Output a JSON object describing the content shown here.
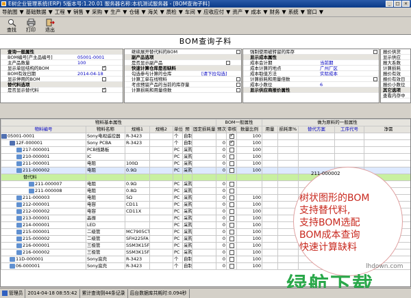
{
  "window": {
    "title": "E树企业管理系统(ERP) 5版本号:1.20.01  服务器名称:本机测试服务器  - [BOM查询子料]"
  },
  "menu": [
    "导航图",
    "基础数据",
    "工程",
    "销售",
    "采购",
    "生产",
    "仓储",
    "海关",
    "质检",
    "车间",
    "应收应付",
    "资产",
    "成本",
    "财务",
    "系统",
    "窗口"
  ],
  "toolbar": {
    "search": "查找",
    "print": "打印",
    "exit": "退出"
  },
  "form_title": "BOM查询子料",
  "panel1": [
    {
      "t": "sec",
      "label": "查询一般属性"
    },
    {
      "t": "val",
      "label": "BOM编号[产主品编号]",
      "value": "05001-0001"
    },
    {
      "t": "val",
      "label": "主产品数量",
      "value": "100"
    },
    {
      "t": "chk",
      "label": "显示单层结构的BOM",
      "checked": true
    },
    {
      "t": "val",
      "label": "BOM有效日期",
      "value": "2014-04-18"
    },
    {
      "t": "chk",
      "label": "显示停用的BOM",
      "checked": false
    },
    {
      "t": "sec",
      "label": "替代料选项"
    },
    {
      "t": "chk",
      "label": "是否显示替代料",
      "checked": true
    }
  ],
  "panel2": [
    {
      "t": "plain",
      "label": "继续展开替代料的BOM"
    },
    {
      "t": "sec",
      "label": "副产品选项"
    },
    {
      "t": "chk",
      "label": "是否显示副产品",
      "checked": false
    },
    {
      "t": "sec",
      "label": "快速计算仓库是否缺料"
    },
    {
      "t": "val",
      "label": "勾选参与计算的仓库",
      "value": "[请下拉勾选]"
    },
    {
      "t": "plain",
      "label": "计算工单在线物料"
    },
    {
      "t": "plain",
      "label": "考虑预留产品的当前的库存量"
    },
    {
      "t": "plain",
      "label": "计算损耗和用量倍数"
    }
  ],
  "panel3": [
    {
      "t": "plain",
      "label": "强制使用被转留的库存"
    },
    {
      "t": "sec",
      "label": "显示成本属性"
    },
    {
      "t": "val",
      "label": "成本会计期",
      "value": "当前期"
    },
    {
      "t": "val",
      "label": "成本计算的地点",
      "value": "广州厂区"
    },
    {
      "t": "val",
      "label": "成本取值方法",
      "value": "实际成本"
    },
    {
      "t": "plain",
      "label": "计算损耗和用量倍数"
    },
    {
      "t": "val",
      "label": "成本小数位",
      "value": "6"
    },
    {
      "t": "sec",
      "label": "显示供应商报价属性"
    }
  ],
  "panel4": [
    "报价供货",
    "显示供应",
    "报大系数",
    "计算损耗",
    "报价有效",
    "报价有效日",
    "报价小数位",
    "其它选项",
    "查看内存中"
  ],
  "grid": {
    "group_headers": [
      "物料基本属性",
      "BOM一般属性",
      "做为原料的一般属性"
    ],
    "columns": [
      "物料编号",
      "物料名称",
      "规格1",
      "规格2",
      "单位",
      "预",
      "固定损耗量",
      "预次",
      "审核",
      "数量比例",
      "用量",
      "损耗率%",
      "替代方案",
      "工序代号",
      "净需"
    ],
    "rows": [
      {
        "code": "05001-0001",
        "name": "Sony电视遥控器",
        "spec1": "R-3423",
        "spec2": "",
        "unit": "个",
        "src": "自制",
        "fixloss": "",
        "seq": "",
        "aud": true,
        "ratio": "100",
        "usage": "",
        "loss": "",
        "alt": "",
        "op": "",
        "net": ""
      },
      {
        "code": "12F-000001",
        "name": "Sony PCBA",
        "spec1": "R-3423",
        "spec2": "",
        "unit": "个",
        "src": "自制",
        "fixloss": "",
        "seq": "0",
        "aud": true,
        "ratio": "100",
        "usage": "",
        "loss": "",
        "alt": "",
        "op": "",
        "net": ""
      },
      {
        "code": "217-000001",
        "name": "PCB线路板",
        "spec1": "",
        "spec2": "",
        "unit": "PC",
        "src": "采购",
        "fixloss": "",
        "seq": "0",
        "aud": false,
        "ratio": "100",
        "usage": "",
        "loss": "",
        "alt": "",
        "op": "",
        "net": ""
      },
      {
        "code": "210-000001",
        "name": "IC",
        "spec1": "",
        "spec2": "",
        "unit": "PC",
        "src": "采购",
        "fixloss": "",
        "seq": "0",
        "aud": false,
        "ratio": "100",
        "usage": "",
        "loss": "",
        "alt": "",
        "op": "",
        "net": ""
      },
      {
        "code": "211-000001",
        "name": "电阻",
        "spec1": "100Ω",
        "spec2": "",
        "unit": "PC",
        "src": "采购",
        "fixloss": "",
        "seq": "0",
        "aud": false,
        "ratio": "100",
        "usage": "",
        "loss": "",
        "alt": "",
        "op": "",
        "net": ""
      },
      {
        "code": "211-000002",
        "name": "电阻",
        "spec1": "0.9Ω",
        "spec2": "",
        "unit": "PC",
        "src": "采购",
        "fixloss": "",
        "seq": "0",
        "aud": false,
        "ratio": "100",
        "usage": "",
        "loss": "",
        "alt": "",
        "op": "",
        "net": ""
      },
      {
        "code": "替代料",
        "name": "",
        "spec1": "",
        "spec2": "",
        "unit": "",
        "src": "",
        "fixloss": "",
        "seq": "",
        "aud": null,
        "ratio": "",
        "usage": "",
        "loss": "",
        "alt": "",
        "op": "",
        "net": ""
      },
      {
        "code": "211-000007",
        "name": "电阻",
        "spec1": "0.9Ω",
        "spec2": "",
        "unit": "PC",
        "src": "采购",
        "fixloss": "",
        "seq": "0",
        "aud": false,
        "ratio": "",
        "usage": "",
        "loss": "",
        "alt": "",
        "op": "",
        "net": ""
      },
      {
        "code": "211-000008",
        "name": "电阻",
        "spec1": "0.8Ω",
        "spec2": "",
        "unit": "PC",
        "src": "采购",
        "fixloss": "",
        "seq": "0",
        "aud": false,
        "ratio": "",
        "usage": "",
        "loss": "",
        "alt": "",
        "op": "",
        "net": ""
      },
      {
        "code": "211-000003",
        "name": "电阻",
        "spec1": "5Ω",
        "spec2": "",
        "unit": "PC",
        "src": "采购",
        "fixloss": "",
        "seq": "0",
        "aud": false,
        "ratio": "100",
        "usage": "",
        "loss": "",
        "alt": "",
        "op": "",
        "net": ""
      },
      {
        "code": "212-000001",
        "name": "电容",
        "spec1": "CD11",
        "spec2": "",
        "unit": "PC",
        "src": "采购",
        "fixloss": "",
        "seq": "0",
        "aud": false,
        "ratio": "100",
        "usage": "",
        "loss": "",
        "alt": "",
        "op": "",
        "net": ""
      },
      {
        "code": "212-000002",
        "name": "电容",
        "spec1": "CD11X",
        "spec2": "",
        "unit": "PC",
        "src": "采购",
        "fixloss": "",
        "seq": "0",
        "aud": false,
        "ratio": "100",
        "usage": "",
        "loss": "",
        "alt": "",
        "op": "",
        "net": ""
      },
      {
        "code": "213-000001",
        "name": "晶振",
        "spec1": "",
        "spec2": "",
        "unit": "PC",
        "src": "采购",
        "fixloss": "",
        "seq": "0",
        "aud": false,
        "ratio": "100",
        "usage": "",
        "loss": "",
        "alt": "",
        "op": "",
        "net": ""
      },
      {
        "code": "214-000001",
        "name": "LED",
        "spec1": "",
        "spec2": "",
        "unit": "PC",
        "src": "采购",
        "fixloss": "",
        "seq": "0",
        "aud": false,
        "ratio": "100",
        "usage": "",
        "loss": "",
        "alt": "",
        "op": "",
        "net": ""
      },
      {
        "code": "215-000001",
        "name": "二级管",
        "spec1": "MC7905CT",
        "spec2": "",
        "unit": "PC",
        "src": "采购",
        "fixloss": "",
        "seq": "0",
        "aud": false,
        "ratio": "100",
        "usage": "",
        "loss": "",
        "alt": "",
        "op": "",
        "net": ""
      },
      {
        "code": "215-000002",
        "name": "二级管",
        "spec1": "SFH225FA",
        "spec2": "",
        "unit": "PC",
        "src": "采购",
        "fixloss": "",
        "seq": "0",
        "aud": false,
        "ratio": "100",
        "usage": "",
        "loss": "",
        "alt": "",
        "op": "",
        "net": ""
      },
      {
        "code": "216-000001",
        "name": "三极管",
        "spec1": "SSM3K15FS",
        "spec2": "",
        "unit": "PC",
        "src": "采购",
        "fixloss": "",
        "seq": "0",
        "aud": false,
        "ratio": "100",
        "usage": "",
        "loss": "",
        "alt": "",
        "op": "",
        "net": ""
      },
      {
        "code": "216-000002",
        "name": "三极管",
        "spec1": "SSM3K15FS",
        "spec2": "",
        "unit": "PC",
        "src": "采购",
        "fixloss": "",
        "seq": "0",
        "aud": false,
        "ratio": "100",
        "usage": "",
        "loss": "",
        "alt": "",
        "op": "",
        "net": ""
      },
      {
        "code": "11D-000001",
        "name": "Sony底壳",
        "spec1": "R-3423",
        "spec2": "",
        "unit": "个",
        "src": "自制",
        "fixloss": "",
        "seq": "0",
        "aud": false,
        "ratio": "100",
        "usage": "",
        "loss": "",
        "alt": "",
        "op": "",
        "net": ""
      },
      {
        "code": "06-000001",
        "name": "Sony底壳",
        "spec1": "R-3423",
        "spec2": "",
        "unit": "个",
        "src": "自制",
        "fixloss": "",
        "seq": "0",
        "aud": false,
        "ratio": "100",
        "usage": "",
        "loss": "",
        "alt": "",
        "op": "",
        "net": ""
      }
    ],
    "floating_code": "211-000002"
  },
  "callout": {
    "lines": [
      "树状图形的BOM",
      "支持替代料,",
      "支持BOM选配",
      "BOM成本查询",
      "快速计算缺料"
    ]
  },
  "watermark": {
    "site": "lhdown.com",
    "brand": "绿航下载"
  },
  "status": [
    "管理员",
    "2014-04-18 08:55:42",
    "累计查询到44条记录",
    "后台数据库共耗时:0.094秒"
  ]
}
